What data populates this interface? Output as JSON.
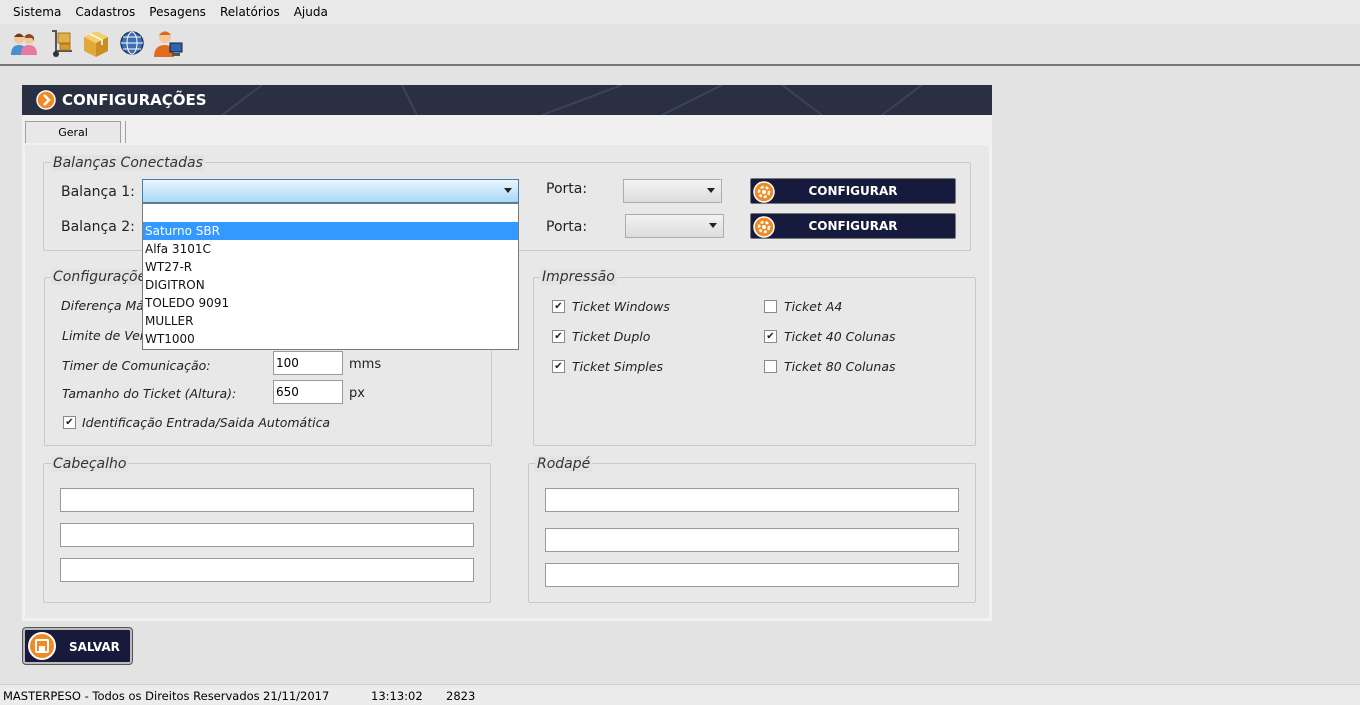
{
  "menu": [
    "Sistema",
    "Cadastros",
    "Pesagens",
    "Relatórios",
    "Ajuda"
  ],
  "toolbar_icons": [
    "users-icon",
    "hand-truck-icon",
    "package-icon",
    "globe-icon",
    "user-computer-icon"
  ],
  "header": {
    "title": "CONFIGURAÇÕES"
  },
  "tabs": [
    {
      "label": "Geral",
      "selected": true
    }
  ],
  "balancas": {
    "group_title": "Balanças Conectadas",
    "balanca1_label": "Balança 1:",
    "balanca2_label": "Balança 2:",
    "porta1_label": "Porta:",
    "porta2_label": "Porta:",
    "configurar1_label": "CONFIGURAR",
    "configurar2_label": "CONFIGURAR",
    "balanca1_value": "",
    "dropdown_options": [
      "",
      "Saturno SBR",
      "Alfa 3101C",
      "WT27-R",
      "DIGITRON",
      "TOLEDO 9091",
      "MULLER",
      "WT1000"
    ],
    "dropdown_selected_index": 1
  },
  "configuracoes": {
    "group_title": "Configurações",
    "diferenca_label": "Diferença Máx",
    "limite_label": "Limite de Vei",
    "timer_label": "Timer de Comunicação:",
    "timer_value": "100",
    "timer_unit": "mms",
    "tamanho_label": "Tamanho do Ticket (Altura):",
    "tamanho_value": "650",
    "tamanho_unit": "px",
    "identificacao_label": "Identificação Entrada/Saida Automática",
    "identificacao_checked": true
  },
  "impressao": {
    "group_title": "Impressão",
    "options": [
      {
        "label": "Ticket Windows",
        "checked": true
      },
      {
        "label": "Ticket Duplo",
        "checked": true
      },
      {
        "label": "Ticket Simples",
        "checked": true
      },
      {
        "label": "Ticket A4",
        "checked": false
      },
      {
        "label": "Ticket 40 Colunas",
        "checked": true
      },
      {
        "label": "Ticket 80 Colunas",
        "checked": false
      }
    ]
  },
  "cabecalho": {
    "group_title": "Cabeçalho",
    "lines": [
      "",
      "",
      ""
    ]
  },
  "rodape": {
    "group_title": "Rodapé",
    "lines": [
      "",
      "",
      ""
    ]
  },
  "save_button": {
    "label": "SALVAR"
  },
  "status": {
    "copyright": "MASTERPESO - Todos os Direitos Reservados",
    "date": "21/11/2017",
    "time": "13:13:02",
    "code": "2823"
  },
  "colors": {
    "header_bg": "#2a3042",
    "button_bg": "#161a3c",
    "accent_orange": "#f08a24",
    "selection_blue": "#3399ff"
  }
}
